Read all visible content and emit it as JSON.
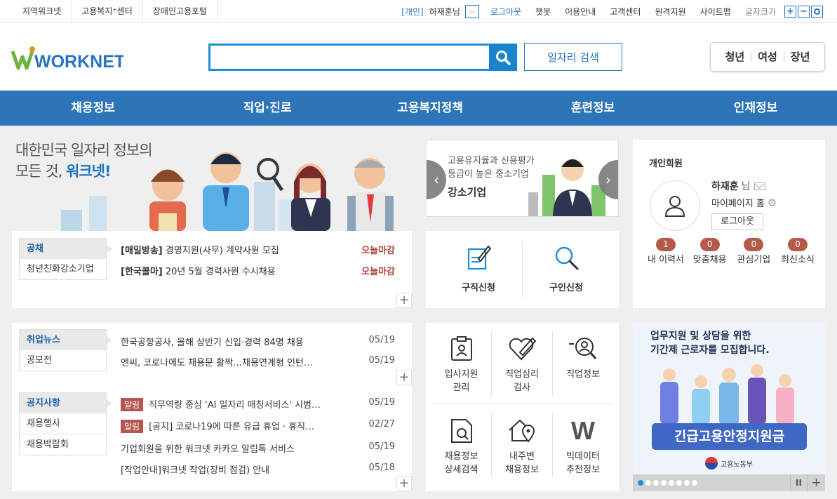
{
  "topbar": {
    "links": [
      "지역워크넷",
      "고용복지⁺센터",
      "장애인고용포털"
    ],
    "user_type": "[개인]",
    "user_name": "하재훈님",
    "logout": "로그아웃",
    "menu": [
      "챗봇",
      "이용안내",
      "고객센터",
      "원격지원",
      "사이트맵"
    ],
    "font_size": "글자크기"
  },
  "header": {
    "logo": "WORKNET",
    "search_placeholder": "",
    "search_button": "일자리 검색",
    "target_tabs": [
      "청년",
      "여성",
      "장년"
    ]
  },
  "gnb": [
    "채용정보",
    "직업·진로",
    "고용복지정책",
    "훈련정보",
    "인재정보"
  ],
  "hero": {
    "line1": "대한민국 일자리 정보의",
    "line2_prefix": "모든 것, ",
    "line2_brand": "워크넷!"
  },
  "banner": {
    "sub1": "고용유지율과 신용평가",
    "sub2": "등급이 높은 중소기업",
    "title": "강소기업"
  },
  "apply": [
    {
      "label": "구직신청",
      "icon": "pen-document-icon"
    },
    {
      "label": "구인신청",
      "icon": "magnifier-icon"
    }
  ],
  "member": {
    "title": "개인회원",
    "name": "하재훈",
    "name_suffix": "님",
    "mypage": "마이페이지 홈",
    "logout": "로그아웃",
    "stats": [
      {
        "count": "1",
        "label": "내 이력서"
      },
      {
        "count": "0",
        "label": "맞춤채용"
      },
      {
        "count": "0",
        "label": "관심기업"
      },
      {
        "count": "0",
        "label": "최신소식"
      }
    ]
  },
  "recruit": {
    "tabs": [
      "공채",
      "청년친화강소기업"
    ],
    "rows": [
      {
        "company": "[매일방송]",
        "title": "경영지원(사무) 계약사원 모집",
        "due": "오늘마감"
      },
      {
        "company": "[한국콜마]",
        "title": "20년 5월 경력사원 수시채용",
        "due": "오늘마감"
      }
    ]
  },
  "news": {
    "tabs": [
      "취업뉴스",
      "공모전"
    ],
    "rows": [
      {
        "title": "한국공항공사, 올해 상반기 신입·경력 84명 채용",
        "date": "05/19"
      },
      {
        "title": "엔씨, 코로나에도 채용문 활짝…채용연계형 인턴…",
        "date": "05/19"
      }
    ]
  },
  "notice": {
    "tabs": [
      "공지사항",
      "채용행사",
      "채용박람회"
    ],
    "rows": [
      {
        "tag": "알림",
        "title": "직무역량 중심 'AI 일자리 매칭서비스' 시범…",
        "date": "05/19"
      },
      {
        "tag": "알림",
        "title": "[공지] 코로나19에 따른 유급 휴업 · 휴직…",
        "date": "02/27"
      },
      {
        "tag": "",
        "title": "기업회원을 위한 워크넷 카카오 알림톡 서비스",
        "date": "05/19"
      },
      {
        "tag": "",
        "title": "[작업안내]워크넷 작업(장비 점검) 안내",
        "date": "05/18"
      }
    ]
  },
  "services": [
    {
      "l1": "입사지원",
      "l2": "관리"
    },
    {
      "l1": "직업심리",
      "l2": "검사"
    },
    {
      "l1": "직업정보",
      "l2": ""
    },
    {
      "l1": "채용정보",
      "l2": "상세검색"
    },
    {
      "l1": "내주변",
      "l2": "채용정보"
    },
    {
      "l1": "빅데이터",
      "l2": "추천정보"
    }
  ],
  "ad": {
    "line1": "업무지원 및 상담을 위한",
    "line2": "기간제 근로자를 모집합니다.",
    "banner": "긴급고용안정지원금",
    "ministry": "고용노동부",
    "pause": "II",
    "plus": "+"
  },
  "colors": {
    "primary": "#2d74b8",
    "accent": "#1f8fd8",
    "due": "#b0443b"
  }
}
